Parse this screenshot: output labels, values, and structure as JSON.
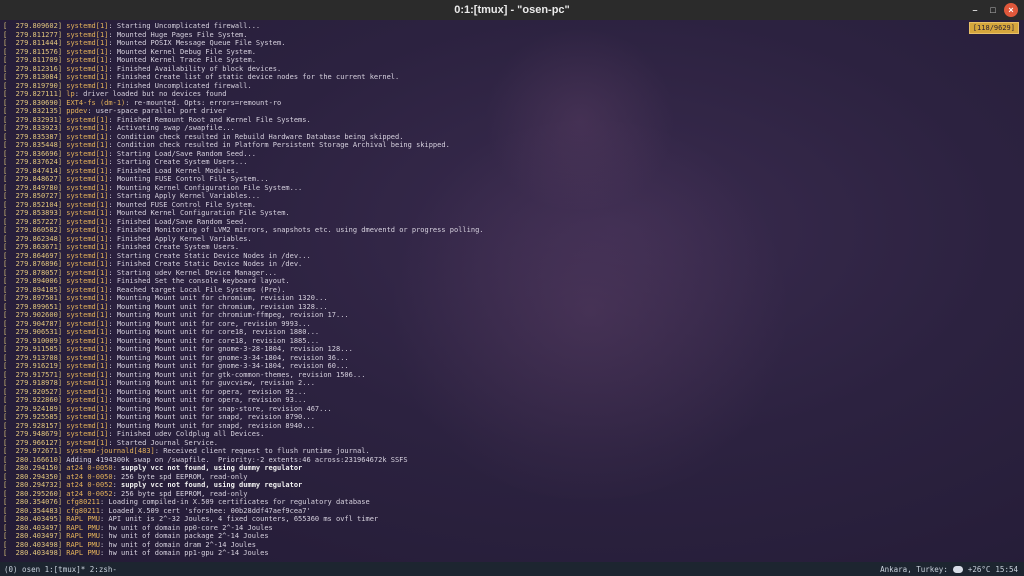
{
  "window": {
    "title": "0:1:[tmux] - \"osen-pc\"",
    "controls": {
      "minimize": "–",
      "maximize": "□",
      "close": "×"
    }
  },
  "terminal": {
    "position_indicator": "[118/9629]",
    "lines": [
      {
        "ts": "279.809602",
        "src": "systemd[1]",
        "msg": "Starting Uncomplicated firewall..."
      },
      {
        "ts": "279.811277",
        "src": "systemd[1]",
        "msg": "Mounted Huge Pages File System."
      },
      {
        "ts": "279.811444",
        "src": "systemd[1]",
        "msg": "Mounted POSIX Message Queue File System."
      },
      {
        "ts": "279.811576",
        "src": "systemd[1]",
        "msg": "Mounted Kernel Debug File System."
      },
      {
        "ts": "279.811709",
        "src": "systemd[1]",
        "msg": "Mounted Kernel Trace File System."
      },
      {
        "ts": "279.812316",
        "src": "systemd[1]",
        "msg": "Finished Availability of block devices."
      },
      {
        "ts": "279.813084",
        "src": "systemd[1]",
        "msg": "Finished Create list of static device nodes for the current kernel."
      },
      {
        "ts": "279.819790",
        "src": "systemd[1]",
        "msg": "Finished Uncomplicated firewall."
      },
      {
        "ts": "279.827111",
        "src": "lp",
        "msg": "driver loaded but no devices found"
      },
      {
        "ts": "279.830690",
        "src": "EXT4-fs (dm-1)",
        "msg": "re-mounted. Opts: errors=remount-ro"
      },
      {
        "ts": "279.832135",
        "src": "ppdev",
        "msg": "user-space parallel port driver"
      },
      {
        "ts": "279.832931",
        "src": "systemd[1]",
        "msg": "Finished Remount Root and Kernel File Systems."
      },
      {
        "ts": "279.833923",
        "src": "systemd[1]",
        "msg": "Activating swap /swapfile..."
      },
      {
        "ts": "279.835387",
        "src": "systemd[1]",
        "msg": "Condition check resulted in Rebuild Hardware Database being skipped."
      },
      {
        "ts": "279.835448",
        "src": "systemd[1]",
        "msg": "Condition check resulted in Platform Persistent Storage Archival being skipped."
      },
      {
        "ts": "279.836696",
        "src": "systemd[1]",
        "msg": "Starting Load/Save Random Seed..."
      },
      {
        "ts": "279.837624",
        "src": "systemd[1]",
        "msg": "Starting Create System Users..."
      },
      {
        "ts": "279.847414",
        "src": "systemd[1]",
        "msg": "Finished Load Kernel Modules."
      },
      {
        "ts": "279.848627",
        "src": "systemd[1]",
        "msg": "Mounting FUSE Control File System..."
      },
      {
        "ts": "279.849780",
        "src": "systemd[1]",
        "msg": "Mounting Kernel Configuration File System..."
      },
      {
        "ts": "279.850727",
        "src": "systemd[1]",
        "msg": "Starting Apply Kernel Variables..."
      },
      {
        "ts": "279.852104",
        "src": "systemd[1]",
        "msg": "Mounted FUSE Control File System."
      },
      {
        "ts": "279.853893",
        "src": "systemd[1]",
        "msg": "Mounted Kernel Configuration File System."
      },
      {
        "ts": "279.857227",
        "src": "systemd[1]",
        "msg": "Finished Load/Save Random Seed."
      },
      {
        "ts": "279.860582",
        "src": "systemd[1]",
        "msg": "Finished Monitoring of LVM2 mirrors, snapshots etc. using dmeventd or progress polling."
      },
      {
        "ts": "279.862348",
        "src": "systemd[1]",
        "msg": "Finished Apply Kernel Variables."
      },
      {
        "ts": "279.863671",
        "src": "systemd[1]",
        "msg": "Finished Create System Users."
      },
      {
        "ts": "279.864697",
        "src": "systemd[1]",
        "msg": "Starting Create Static Device Nodes in /dev..."
      },
      {
        "ts": "279.876896",
        "src": "systemd[1]",
        "msg": "Finished Create Static Device Nodes in /dev."
      },
      {
        "ts": "279.878057",
        "src": "systemd[1]",
        "msg": "Starting udev Kernel Device Manager..."
      },
      {
        "ts": "279.894006",
        "src": "systemd[1]",
        "msg": "Finished Set the console keyboard layout."
      },
      {
        "ts": "279.894185",
        "src": "systemd[1]",
        "msg": "Reached target Local File Systems (Pre)."
      },
      {
        "ts": "279.897501",
        "src": "systemd[1]",
        "msg": "Mounting Mount unit for chromium, revision 1320..."
      },
      {
        "ts": "279.899651",
        "src": "systemd[1]",
        "msg": "Mounting Mount unit for chromium, revision 1328..."
      },
      {
        "ts": "279.902600",
        "src": "systemd[1]",
        "msg": "Mounting Mount unit for chromium-ffmpeg, revision 17..."
      },
      {
        "ts": "279.904787",
        "src": "systemd[1]",
        "msg": "Mounting Mount unit for core, revision 9993..."
      },
      {
        "ts": "279.906531",
        "src": "systemd[1]",
        "msg": "Mounting Mount unit for core18, revision 1880..."
      },
      {
        "ts": "279.910009",
        "src": "systemd[1]",
        "msg": "Mounting Mount unit for core18, revision 1885..."
      },
      {
        "ts": "279.911585",
        "src": "systemd[1]",
        "msg": "Mounting Mount unit for gnome-3-28-1804, revision 128..."
      },
      {
        "ts": "279.913708",
        "src": "systemd[1]",
        "msg": "Mounting Mount unit for gnome-3-34-1804, revision 36..."
      },
      {
        "ts": "279.916219",
        "src": "systemd[1]",
        "msg": "Mounting Mount unit for gnome-3-34-1804, revision 60..."
      },
      {
        "ts": "279.917571",
        "src": "systemd[1]",
        "msg": "Mounting Mount unit for gtk-common-themes, revision 1506..."
      },
      {
        "ts": "279.918978",
        "src": "systemd[1]",
        "msg": "Mounting Mount unit for guvcview, revision 2..."
      },
      {
        "ts": "279.920527",
        "src": "systemd[1]",
        "msg": "Mounting Mount unit for opera, revision 92..."
      },
      {
        "ts": "279.922860",
        "src": "systemd[1]",
        "msg": "Mounting Mount unit for opera, revision 93..."
      },
      {
        "ts": "279.924189",
        "src": "systemd[1]",
        "msg": "Mounting Mount unit for snap-store, revision 467..."
      },
      {
        "ts": "279.925585",
        "src": "systemd[1]",
        "msg": "Mounting Mount unit for snapd, revision 8790..."
      },
      {
        "ts": "279.928157",
        "src": "systemd[1]",
        "msg": "Mounting Mount unit for snapd, revision 8940..."
      },
      {
        "ts": "279.948679",
        "src": "systemd[1]",
        "msg": "Finished udev Coldplug all Devices."
      },
      {
        "ts": "279.966127",
        "src": "systemd[1]",
        "msg": "Started Journal Service."
      },
      {
        "ts": "279.972671",
        "src": "systemd-journald[483]",
        "msg": "Received client request to flush runtime journal."
      },
      {
        "ts": "280.166610",
        "src": "",
        "msg": "Adding 4194300k swap on /swapfile.  Priority:-2 extents:46 across:231964672k SSFS"
      },
      {
        "ts": "280.294150",
        "src": "at24 0-0050",
        "msg": "supply vcc not found, using dummy regulator",
        "bold": true
      },
      {
        "ts": "280.294350",
        "src": "at24 0-0050",
        "msg": "256 byte spd EEPROM, read-only"
      },
      {
        "ts": "280.294732",
        "src": "at24 0-0052",
        "msg": "supply vcc not found, using dummy regulator",
        "bold": true
      },
      {
        "ts": "280.295260",
        "src": "at24 0-0052",
        "msg": "256 byte spd EEPROM, read-only"
      },
      {
        "ts": "280.354076",
        "src": "cfg80211",
        "msg": "Loading compiled-in X.509 certificates for regulatory database"
      },
      {
        "ts": "280.354483",
        "src": "cfg80211",
        "msg": "Loaded X.509 cert 'sforshee: 00b28ddf47aef9cea7'"
      },
      {
        "ts": "280.403495",
        "src": "RAPL PMU",
        "msg": "API unit is 2^-32 Joules, 4 fixed counters, 655360 ms ovfl timer"
      },
      {
        "ts": "280.403497",
        "src": "RAPL PMU",
        "msg": "hw unit of domain pp0-core 2^-14 Joules"
      },
      {
        "ts": "280.403497",
        "src": "RAPL PMU",
        "msg": "hw unit of domain package 2^-14 Joules"
      },
      {
        "ts": "280.403498",
        "src": "RAPL PMU",
        "msg": "hw unit of domain dram 2^-14 Joules"
      },
      {
        "ts": "280.403498",
        "src": "RAPL PMU",
        "msg": "hw unit of domain pp1-gpu 2^-14 Joules"
      }
    ]
  },
  "statusbar": {
    "left": "(0) osen 1:[tmux]* 2:zsh-",
    "location": "Ankara, Turkey:",
    "weather_icon": "partly-cloudy-icon",
    "temperature": "+26°C",
    "time": "15:54"
  },
  "colors": {
    "timestamp": "#e3c77d",
    "source": "#e4b25a",
    "indicator_bg": "#d6a63c"
  }
}
